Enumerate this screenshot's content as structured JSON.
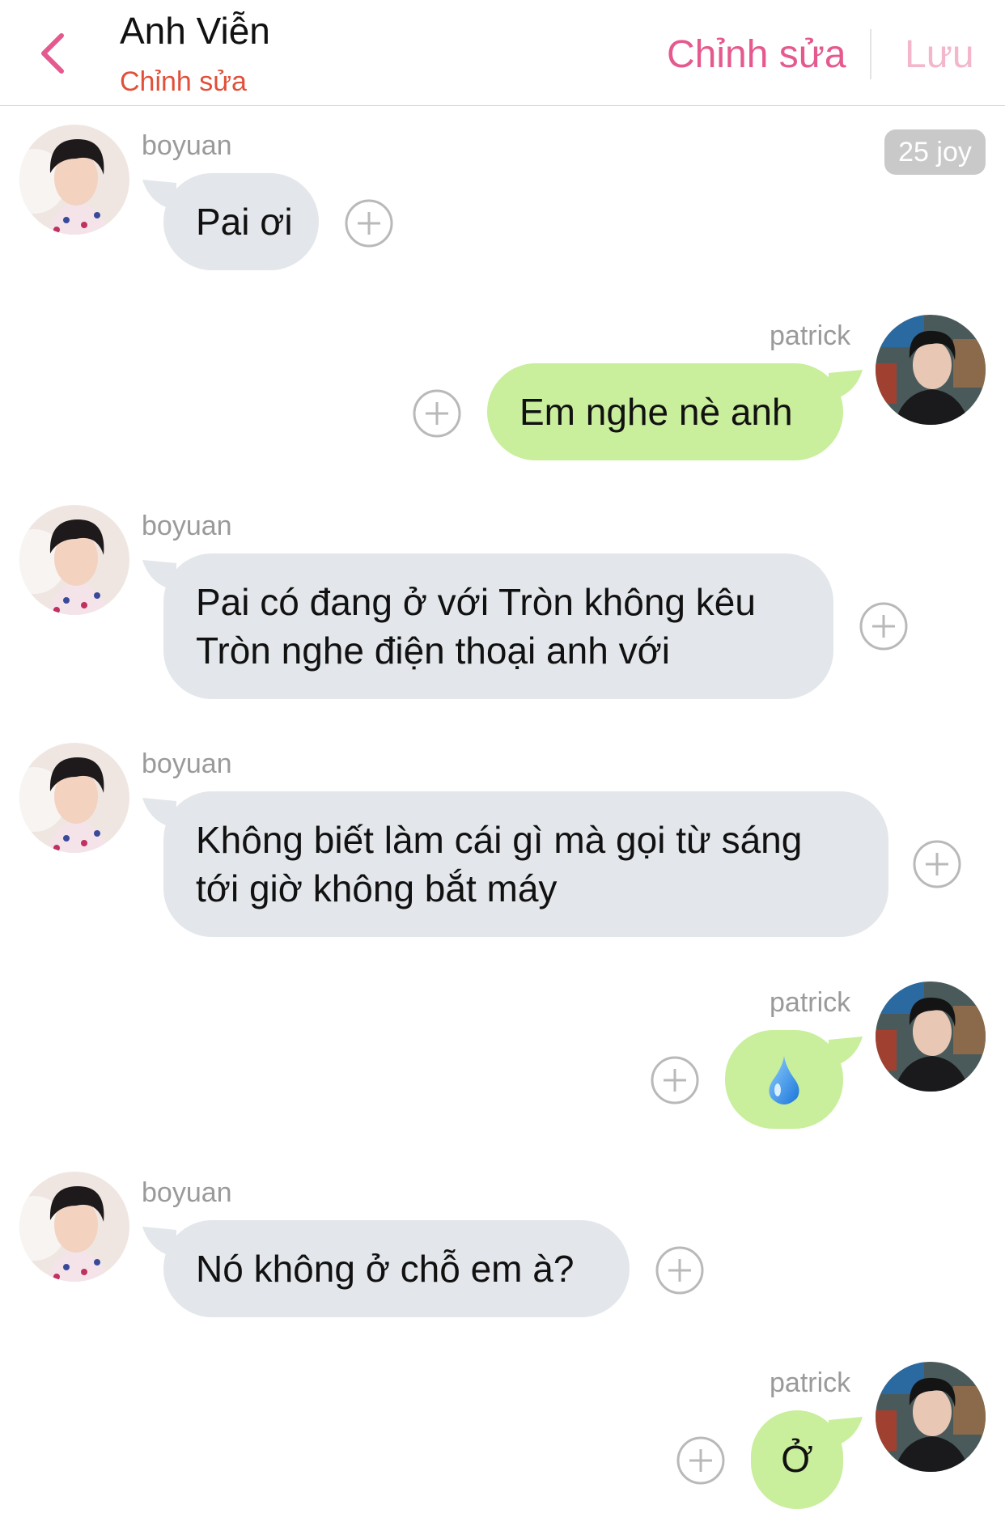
{
  "header": {
    "contact_name": "Anh Viễn",
    "subtitle": "Chỉnh sửa",
    "edit_label": "Chỉnh sửa",
    "save_label": "Lưu"
  },
  "badge": {
    "label": "25 joy"
  },
  "colors": {
    "accent_pink": "#e55a8e",
    "save_disabled": "#f4b6cb",
    "subtitle_red": "#e0503a",
    "incoming_bubble": "#e3e6ea",
    "outgoing_bubble": "#c9ee9c"
  },
  "messages": [
    {
      "sender": "boyuan",
      "direction": "incoming",
      "lines": [
        "Pai ơi"
      ]
    },
    {
      "sender": "patrick",
      "direction": "outgoing",
      "lines": [
        "Em nghe nè anh"
      ]
    },
    {
      "sender": "boyuan",
      "direction": "incoming",
      "lines": [
        "Pai có đang ở với Tròn không kêu",
        "Tròn nghe điện thoại anh với"
      ]
    },
    {
      "sender": "boyuan",
      "direction": "incoming",
      "lines": [
        "Không biết làm cái gì mà gọi từ sáng",
        "tới giờ không bắt máy"
      ]
    },
    {
      "sender": "patrick",
      "direction": "outgoing",
      "lines": [
        "💧"
      ],
      "icon": "droplet-emoji"
    },
    {
      "sender": "boyuan",
      "direction": "incoming",
      "lines": [
        "Nó không ở chỗ em à?"
      ]
    },
    {
      "sender": "patrick",
      "direction": "outgoing",
      "lines": [
        "Ở"
      ]
    }
  ]
}
